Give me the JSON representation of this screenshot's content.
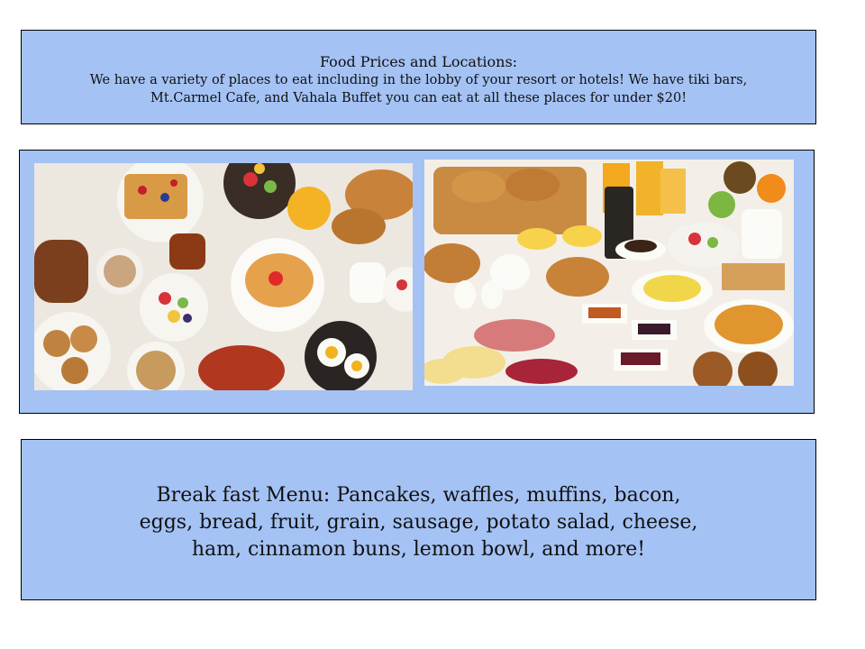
{
  "info_box": {
    "title": "Food Prices and Locations:",
    "body": "We have a variety of places to eat including in the lobby of your resort or hotels! We have tiki bars, Mt.Carmel Cafe, and Vahala Buffet you can eat at all these places for under $20!"
  },
  "menu_box": {
    "text": "Break fast Menu: Pancakes, waffles, muffins, bacon, eggs, bread, fruit, grain, sausage, potato salad, cheese, ham, cinnamon buns, lemon bowl, and more!"
  },
  "colors": {
    "box_fill": "#a4c2f4",
    "border": "#000000"
  }
}
